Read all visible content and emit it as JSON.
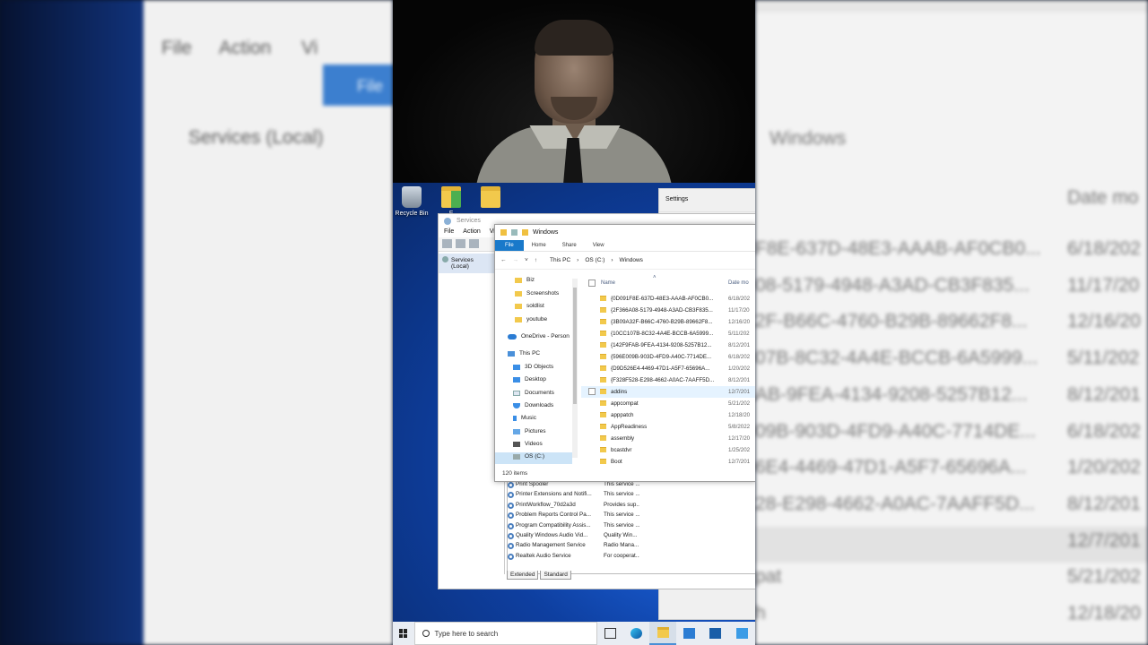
{
  "background": {
    "services_menu": [
      "File",
      "Action",
      "Vi"
    ],
    "services_tree": "Services (Local)",
    "ribbon_file": "File",
    "folder_title": "Windows",
    "date_header": "Date mo",
    "rows": [
      {
        "name": "F8E-637D-48E3-AAAB-AF0CB0...",
        "date": "6/18/202"
      },
      {
        "name": "08-5179-4948-A3AD-CB3F835...",
        "date": "11/17/20"
      },
      {
        "name": "2F-B66C-4760-B29B-89662F8...",
        "date": "12/16/20"
      },
      {
        "name": "07B-8C32-4A4E-BCCB-6A5999...",
        "date": "5/11/202"
      },
      {
        "name": "AB-9FEA-4134-9208-5257B12...",
        "date": "8/12/201"
      },
      {
        "name": "09B-903D-4FD9-A40C-7714DE...",
        "date": "6/18/202"
      },
      {
        "name": "6E4-4469-47D1-A5F7-65696A...",
        "date": "1/20/202"
      },
      {
        "name": "28-E298-4662-A0AC-7AAFF5D...",
        "date": "8/12/201"
      },
      {
        "name": "",
        "date": "12/7/201"
      },
      {
        "name": "pat",
        "date": "5/21/202"
      },
      {
        "name": "h",
        "date": "12/18/20"
      }
    ]
  },
  "desktop": {
    "icons": [
      {
        "label": "Recycle Bin"
      },
      {
        "label": "F"
      },
      {
        "label": ""
      }
    ]
  },
  "settings": {
    "title": "Settings"
  },
  "services": {
    "title": "Services",
    "menu": [
      "File",
      "Action",
      "Vi"
    ],
    "tree_node": "Services (Local)",
    "rows": [
      {
        "name": "Print Spooler",
        "desc": "This service ..."
      },
      {
        "name": "Printer Extensions and Notifi...",
        "desc": "This service ..."
      },
      {
        "name": "PrintWorkflow_70d2a3d",
        "desc": "Provides sup..."
      },
      {
        "name": "Problem Reports Control Pa...",
        "desc": "This service ..."
      },
      {
        "name": "Program Compatibility Assis...",
        "desc": "This service ..."
      },
      {
        "name": "Quality Windows Audio Vid...",
        "desc": "Quality Win..."
      },
      {
        "name": "Radio Management Service",
        "desc": "Radio Mana..."
      },
      {
        "name": "Realtek Audio Service",
        "desc": "For cooperat..."
      }
    ],
    "tabs": [
      "Extended",
      "Standard"
    ]
  },
  "explorer": {
    "title": "Windows",
    "ribbon_tabs": [
      "File",
      "Home",
      "Share",
      "View"
    ],
    "breadcrumb": [
      "This PC",
      "OS (C:)",
      "Windows"
    ],
    "nav_items": [
      {
        "label": "Biz",
        "icon": "folder-icon"
      },
      {
        "label": "Screenshots",
        "icon": "folder-icon"
      },
      {
        "label": "soldlist",
        "icon": "folder-icon"
      },
      {
        "label": "youtube",
        "icon": "folder-icon"
      },
      {
        "label": "OneDrive - Person",
        "icon": "onedrive-icon"
      },
      {
        "label": "This PC",
        "icon": "pc-icon"
      },
      {
        "label": "3D Objects",
        "icon": "3d-objects-icon"
      },
      {
        "label": "Desktop",
        "icon": "desktop-icon"
      },
      {
        "label": "Documents",
        "icon": "documents-icon"
      },
      {
        "label": "Downloads",
        "icon": "downloads-icon"
      },
      {
        "label": "Music",
        "icon": "music-icon"
      },
      {
        "label": "Pictures",
        "icon": "pictures-icon"
      },
      {
        "label": "Videos",
        "icon": "videos-icon"
      },
      {
        "label": "OS (C:)",
        "icon": "drive-icon"
      }
    ],
    "columns": {
      "name": "Name",
      "date": "Date mo"
    },
    "files": [
      {
        "name": "{0D091F8E-637D-48E3-AAAB-AF0CB0...",
        "date": "6/18/202"
      },
      {
        "name": "{2F366A08-5179-4948-A3AD-CB3F835...",
        "date": "11/17/20"
      },
      {
        "name": "{3B09A32F-B66C-4760-B29B-89662F8...",
        "date": "12/16/20"
      },
      {
        "name": "{10CC107B-8C32-4A4E-BCCB-6A5999...",
        "date": "5/11/202"
      },
      {
        "name": "{142F9FAB-9FEA-4134-9208-5257B12...",
        "date": "8/12/201"
      },
      {
        "name": "{596E009B-903D-4FD9-A40C-7714DE...",
        "date": "6/18/202"
      },
      {
        "name": "{D9D526E4-4469-47D1-A5F7-65696A...",
        "date": "1/20/202"
      },
      {
        "name": "{F328F528-E298-4662-A0AC-7AAFF5D...",
        "date": "8/12/201"
      },
      {
        "name": "addins",
        "date": "12/7/201"
      },
      {
        "name": "appcompat",
        "date": "5/21/202"
      },
      {
        "name": "apppatch",
        "date": "12/18/20"
      },
      {
        "name": "AppReadiness",
        "date": "5/8/2022"
      },
      {
        "name": "assembly",
        "date": "12/17/20"
      },
      {
        "name": "bcastdvr",
        "date": "1/25/202"
      },
      {
        "name": "Boot",
        "date": "12/7/201"
      }
    ],
    "status": "120 items"
  },
  "taskbar": {
    "search_placeholder": "Type here to search",
    "icons": [
      "task-view-icon",
      "edge-icon",
      "file-explorer-icon",
      "mail-icon",
      "store-icon",
      "photos-icon"
    ]
  },
  "colors": {
    "accent": "#1979ca",
    "folder": "#f2c94c",
    "hover": "#e5f3ff"
  }
}
